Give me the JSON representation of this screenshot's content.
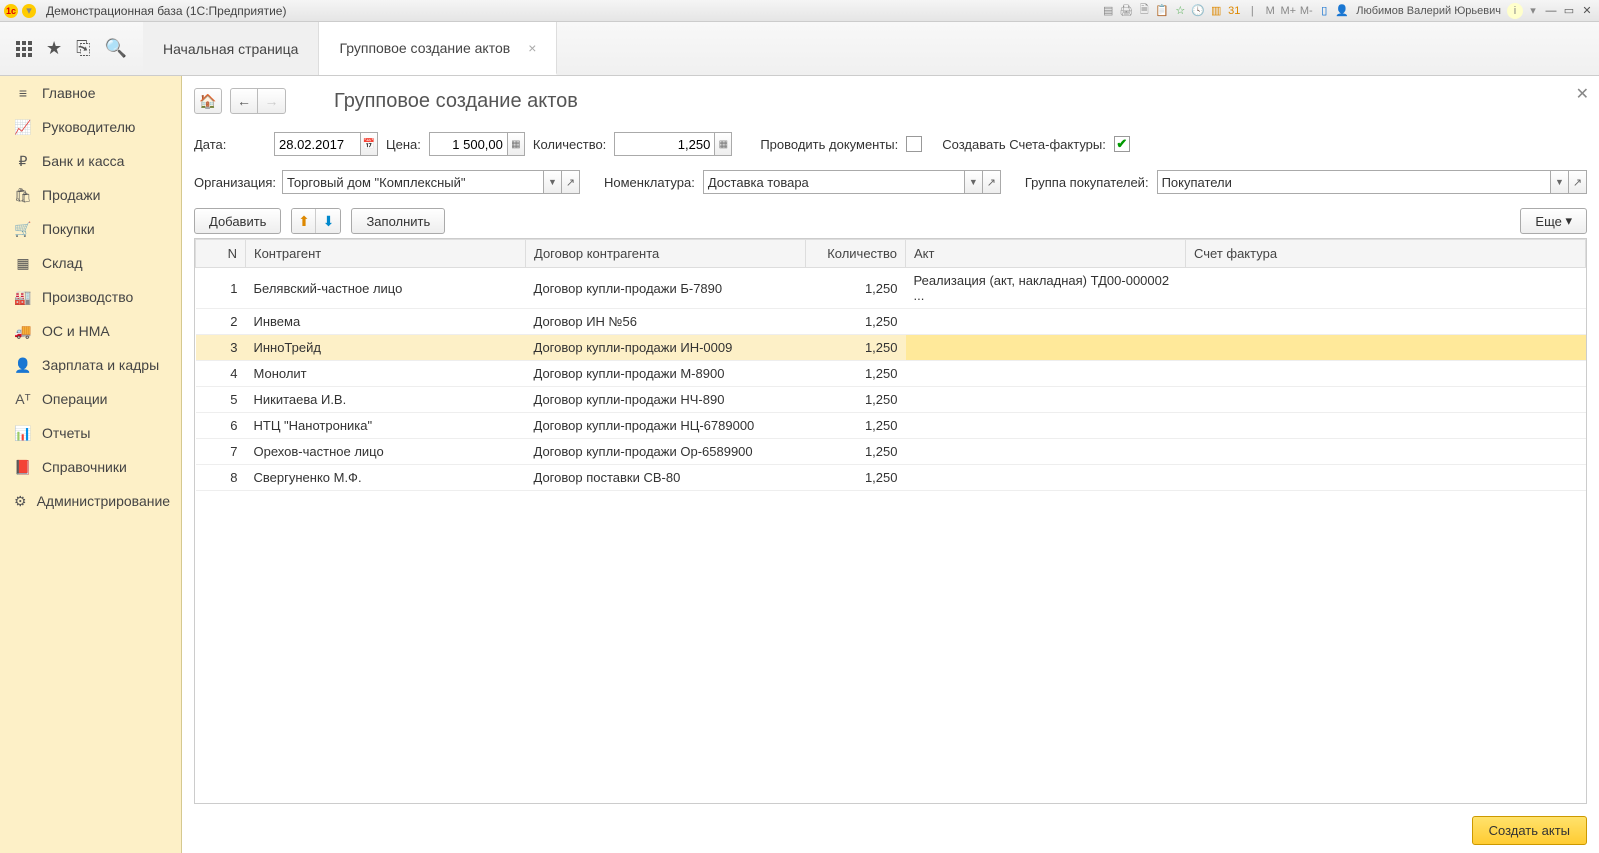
{
  "titlebar": {
    "app_title": "Демонстрационная база  (1С:Предприятие)",
    "user": "Любимов Валерий Юрьевич",
    "m_labels": [
      "M",
      "M+",
      "M-"
    ]
  },
  "tool_icons": {
    "star": "★",
    "task": "⎘",
    "search": "🔍"
  },
  "tabs": [
    {
      "label": "Начальная страница",
      "active": false,
      "closable": false
    },
    {
      "label": "Групповое создание актов",
      "active": true,
      "closable": true
    }
  ],
  "sidebar": [
    {
      "icon": "≡",
      "label": "Главное"
    },
    {
      "icon": "📈",
      "label": "Руководителю"
    },
    {
      "icon": "₽",
      "label": "Банк и касса"
    },
    {
      "icon": "🛍",
      "label": "Продажи"
    },
    {
      "icon": "🛒",
      "label": "Покупки"
    },
    {
      "icon": "▦",
      "label": "Склад"
    },
    {
      "icon": "🏭",
      "label": "Производство"
    },
    {
      "icon": "🚚",
      "label": "ОС и НМА"
    },
    {
      "icon": "👤",
      "label": "Зарплата и кадры"
    },
    {
      "icon": "Aᵀ",
      "label": "Операции"
    },
    {
      "icon": "📊",
      "label": "Отчеты"
    },
    {
      "icon": "📕",
      "label": "Справочники"
    },
    {
      "icon": "⚙",
      "label": "Администрирование"
    }
  ],
  "page": {
    "title": "Групповое создание актов",
    "nav": {
      "home": "🏠",
      "back": "←",
      "fwd": "→"
    },
    "close": "✕"
  },
  "form": {
    "date_label": "Дата:",
    "date_value": "28.02.2017",
    "price_label": "Цена:",
    "price_value": "1 500,00",
    "qty_label": "Количество:",
    "qty_value": "1,250",
    "conduct_label": "Проводить документы:",
    "conduct_checked": false,
    "invoice_label": "Создавать Счета-фактуры:",
    "invoice_checked": true,
    "org_label": "Организация:",
    "org_value": "Торговый дом \"Комплексный\"",
    "nomen_label": "Номенклатура:",
    "nomen_value": "Доставка товара",
    "group_label": "Группа покупателей:",
    "group_value": "Покупатели"
  },
  "toolbar": {
    "add": "Добавить",
    "fill": "Заполнить",
    "more": "Еще",
    "up": "⬆",
    "down": "⬇"
  },
  "columns": {
    "n": "N",
    "counterparty": "Контрагент",
    "contract": "Договор контрагента",
    "qty": "Количество",
    "akt": "Акт",
    "sf": "Счет фактура"
  },
  "rows": [
    {
      "n": 1,
      "cp": "Белявский-частное лицо",
      "ct": "Договор купли-продажи Б-7890",
      "qty": "1,250",
      "akt": "Реализация (акт, накладная) ТД00-000002 ...",
      "sf": "",
      "hl": false
    },
    {
      "n": 2,
      "cp": "Инвема",
      "ct": "Договор ИН №56",
      "qty": "1,250",
      "akt": "",
      "sf": "",
      "hl": false
    },
    {
      "n": 3,
      "cp": "ИнноТрейд",
      "ct": "Договор купли-продажи ИН-0009",
      "qty": "1,250",
      "akt": "",
      "sf": "",
      "hl": true
    },
    {
      "n": 4,
      "cp": "Монолит",
      "ct": "Договор купли-продажи М-8900",
      "qty": "1,250",
      "akt": "",
      "sf": "",
      "hl": false
    },
    {
      "n": 5,
      "cp": "Никитаева И.В.",
      "ct": "Договор купли-продажи НЧ-890",
      "qty": "1,250",
      "akt": "",
      "sf": "",
      "hl": false
    },
    {
      "n": 6,
      "cp": "НТЦ \"Нанотроника\"",
      "ct": "Договор купли-продажи НЦ-6789000",
      "qty": "1,250",
      "akt": "",
      "sf": "",
      "hl": false
    },
    {
      "n": 7,
      "cp": "Орехов-частное лицо",
      "ct": "Договор купли-продажи Ор-6589900",
      "qty": "1,250",
      "akt": "",
      "sf": "",
      "hl": false
    },
    {
      "n": 8,
      "cp": "Свергуненко М.Ф.",
      "ct": "Договор поставки СВ-80",
      "qty": "1,250",
      "akt": "",
      "sf": "",
      "hl": false
    }
  ],
  "footer": {
    "create": "Создать акты"
  }
}
